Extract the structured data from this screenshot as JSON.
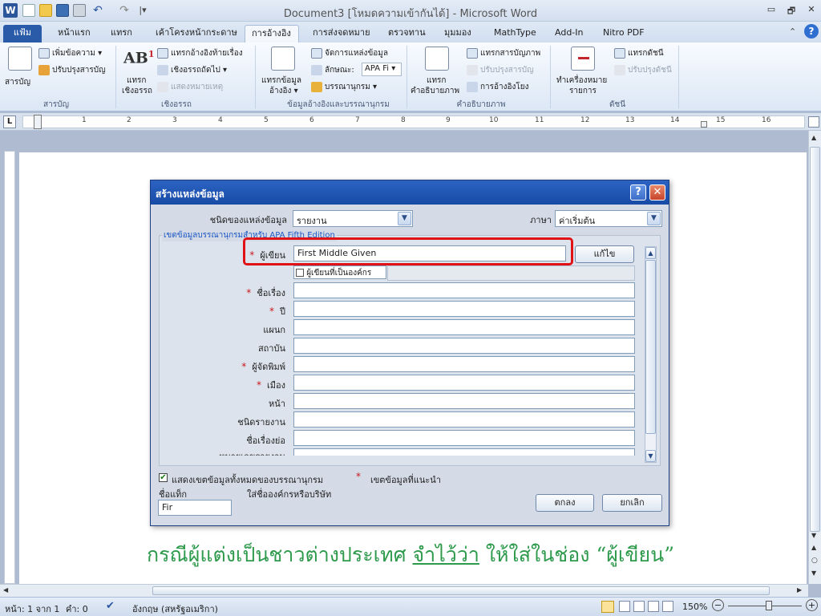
{
  "window": {
    "title": "Document3 [โหมดความเข้ากันได้] - Microsoft Word",
    "app_icon": "W",
    "controls": {
      "minimize": "▭",
      "restore": "🗗",
      "close": "✕"
    },
    "help": "?"
  },
  "quick_access": {
    "undo": "↶",
    "redo": "↷",
    "customize": "|▾"
  },
  "tabs": [
    {
      "label": "แฟ้ม"
    },
    {
      "label": "หน้าแรก"
    },
    {
      "label": "แทรก"
    },
    {
      "label": "เค้าโครงหน้ากระดาษ"
    },
    {
      "label": "การอ้างอิง"
    },
    {
      "label": "การส่งจดหมาย"
    },
    {
      "label": "ตรวจทาน"
    },
    {
      "label": "มุมมอง"
    },
    {
      "label": "MathType"
    },
    {
      "label": "Add-In"
    },
    {
      "label": "Nitro PDF"
    }
  ],
  "ribbon": {
    "toc": {
      "big": "สารบัญ",
      "add_text": "เพิ่มข้อความ ▾",
      "update": "ปรับปรุงสารบัญ",
      "group": "สารบัญ"
    },
    "footnotes": {
      "ab_glyph": "AB",
      "ab_sup": "1",
      "big_line1": "แทรก",
      "big_line2": "เชิงอรรถ",
      "insert_endnote": "แทรกอ้างอิงท้ายเรื่อง",
      "next_footnote": "เชิงอรรถถัดไป ▾",
      "show_notes": "แสดงหมายเหตุ",
      "group": "เชิงอรรถ"
    },
    "citations": {
      "big_line1": "แทรกข้อมูล",
      "big_line2": "อ้างอิง ▾",
      "manage": "จัดการแหล่งข้อมูล",
      "style_label": "ลักษณะ:",
      "style_value": "APA Fi ▾",
      "bibliography": "บรรณานุกรม ▾",
      "group": "ข้อมูลอ้างอิงและบรรณานุกรม"
    },
    "captions": {
      "big_line1": "แทรก",
      "big_line2": "คำอธิบายภาพ",
      "insert_tof": "แทรกสารบัญภาพ",
      "update_table": "ปรับปรุงสารบัญ",
      "cross_ref": "การอ้างอิงโยง",
      "group": "คำอธิบายภาพ"
    },
    "index": {
      "big_line1": "ทำเครื่องหมาย",
      "big_line2": "รายการ",
      "insert_index": "แทรกดัชนี",
      "update_index": "ปรับปรุงดัชนี",
      "group": "ดัชนี"
    }
  },
  "ruler": {
    "tab_marker": "L",
    "numbers": [
      "1",
      "2",
      "3",
      "4",
      "5",
      "6",
      "7",
      "8",
      "9",
      "10",
      "11",
      "12",
      "13",
      "14",
      "15",
      "16"
    ]
  },
  "dialog": {
    "title": "สร้างแหล่งข้อมูล",
    "help_button": "?",
    "close_button": "✕",
    "source_type_label": "ชนิดของแหล่งข้อมูล",
    "source_type_value": "รายงาน",
    "language_label": "ภาษา",
    "language_value": "ค่าเริ่มต้น",
    "fields_legend": "เขตข้อมูลบรรณานุกรมสำหรับ APA Fifth Edition",
    "author_label": "ผู้เขียน",
    "author_value": "First Middle Given",
    "edit_button": "แก้ไข",
    "corporate_author_label": "ผู้เขียนที่เป็นองค์กร",
    "fields": [
      {
        "label": "ชื่อเรื่อง",
        "required": true,
        "value": ""
      },
      {
        "label": "ปี",
        "required": true,
        "value": ""
      },
      {
        "label": "แผนก",
        "required": false,
        "value": ""
      },
      {
        "label": "สถาบัน",
        "required": false,
        "value": ""
      },
      {
        "label": "ผู้จัดพิมพ์",
        "required": true,
        "value": ""
      },
      {
        "label": "เมือง",
        "required": true,
        "value": ""
      },
      {
        "label": "หน้า",
        "required": false,
        "value": ""
      },
      {
        "label": "ชนิดรายงาน",
        "required": false,
        "value": ""
      },
      {
        "label": "ชื่อเรื่องย่อ",
        "required": false,
        "value": ""
      },
      {
        "label": "หมายเลขรายงาน",
        "required": false,
        "value": ""
      }
    ],
    "show_all_label": "แสดงเขตข้อมูลทั้งหมดของบรรณานุกรม",
    "show_all_checked": true,
    "recommended_label": "เขตข้อมูลที่แนะนำ",
    "required_marker": "*",
    "tag_name_label": "ชื่อแท็ก",
    "tag_hint": "ใส่ชื่อองค์กรหรือบริษัท",
    "tag_value": "Fir",
    "ok_button": "ตกลง",
    "cancel_button": "ยกเลิก"
  },
  "caption": {
    "part1": "กรณีผู้แต่งเป็นชาวต่างประเทศ ",
    "underlined": "จำไว้ว่า",
    "part2": " ให้ใส่ในช่อง “ผู้เขียน”"
  },
  "status_bar": {
    "page": "หน้า: 1 จาก 1",
    "words": "คำ: 0",
    "language": "อังกฤษ (สหรัฐอเมริกา)",
    "zoom": "150%"
  },
  "colors": {
    "highlight": "#e01216",
    "caption": "#2e9a4c",
    "dialog_title": "#1f55b5",
    "file_tab": "#2a5ba9"
  }
}
